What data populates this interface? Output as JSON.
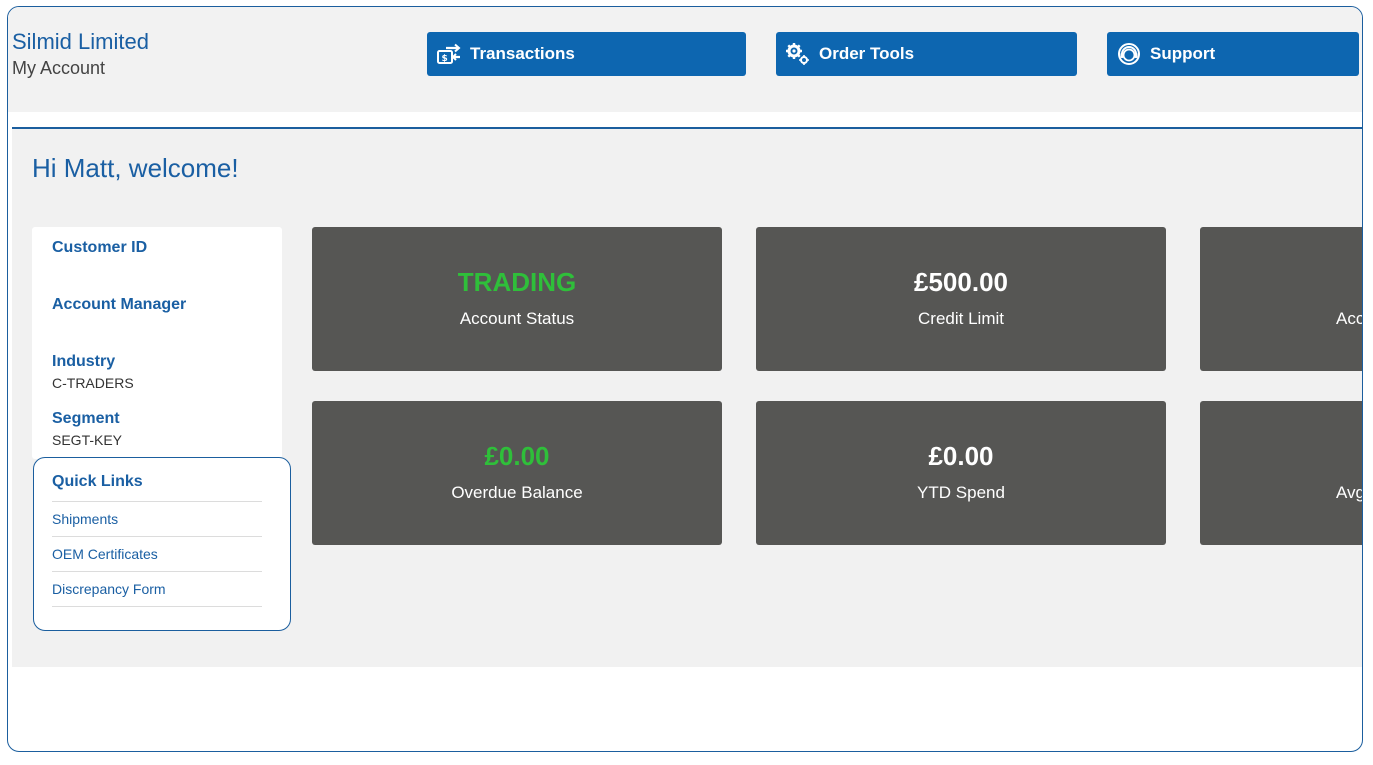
{
  "header": {
    "company": "Silmid Limited",
    "subtitle": "My Account",
    "nav": [
      {
        "label": "Transactions",
        "icon": "transactions-icon"
      },
      {
        "label": "Order Tools",
        "icon": "gears-icon"
      },
      {
        "label": "Support",
        "icon": "support-icon"
      }
    ]
  },
  "main": {
    "welcome": "Hi Matt, welcome!",
    "info": {
      "customer_id_label": "Customer ID",
      "account_manager_label": "Account Manager",
      "industry_label": "Industry",
      "industry_value": "C-TRADERS",
      "segment_label": "Segment",
      "segment_value": "SEGT-KEY"
    },
    "quick_links": {
      "title": "Quick Links",
      "items": [
        "Shipments",
        "OEM Certificates",
        "Discrepancy Form"
      ]
    },
    "tiles": [
      {
        "value": "TRADING",
        "label": "Account Status",
        "value_color": "#2fbf3a"
      },
      {
        "value": "£500.00",
        "label": "Credit Limit",
        "value_color": "#ffffff"
      },
      {
        "value": "",
        "label": "Acc",
        "value_color": "#ffffff"
      },
      {
        "value": "£0.00",
        "label": "Overdue Balance",
        "value_color": "#2fbf3a"
      },
      {
        "value": "£0.00",
        "label": "YTD Spend",
        "value_color": "#ffffff"
      },
      {
        "value": "",
        "label": "Avg",
        "value_color": "#ffffff"
      }
    ]
  },
  "colors": {
    "brand_blue": "#1a5fa3",
    "button_blue": "#0d66b0",
    "tile_grey": "#565654",
    "status_green": "#2fbf3a"
  }
}
